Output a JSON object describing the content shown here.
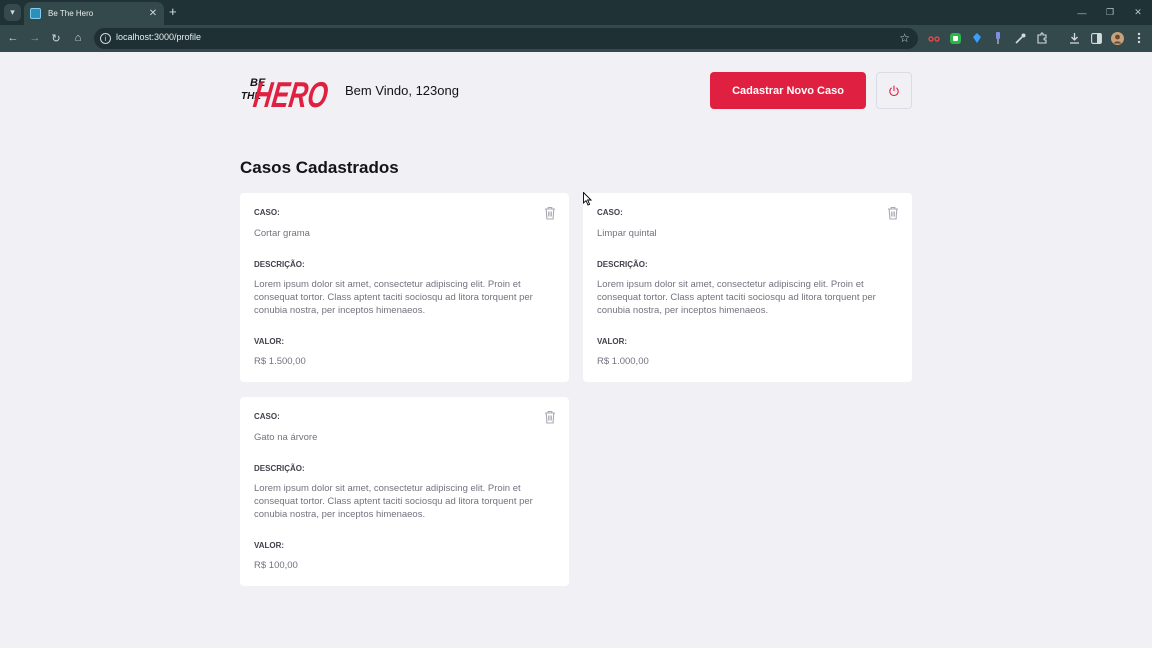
{
  "browser": {
    "tab_title": "Be The Hero",
    "url": "localhost:3000/profile"
  },
  "header": {
    "logo_text_top": "BE",
    "logo_text_mid": "THE",
    "logo_text_big": "HERO",
    "welcome": "Bem Vindo, 123ong",
    "new_case_label": "Cadastrar Novo Caso"
  },
  "page": {
    "title": "Casos Cadastrados"
  },
  "labels": {
    "case": "CASO:",
    "description": "DESCRIÇÃO:",
    "value": "VALOR:"
  },
  "cases": [
    {
      "title": "Cortar grama",
      "description": "Lorem ipsum dolor sit amet, consectetur adipiscing elit. Proin et consequat tortor. Class aptent taciti sociosqu ad litora torquent per conubia nostra, per inceptos himenaeos.",
      "value": "R$ 1.500,00"
    },
    {
      "title": "Limpar quintal",
      "description": "Lorem ipsum dolor sit amet, consectetur adipiscing elit. Proin et consequat tortor. Class aptent taciti sociosqu ad litora torquent per conubia nostra, per inceptos himenaeos.",
      "value": "R$ 1.000,00"
    },
    {
      "title": "Gato na árvore",
      "description": "Lorem ipsum dolor sit amet, consectetur adipiscing elit. Proin et consequat tortor. Class aptent taciti sociosqu ad litora torquent per conubia nostra, per inceptos himenaeos.",
      "value": "R$ 100,00"
    }
  ],
  "colors": {
    "brand": "#e02041",
    "background": "#f0f0f5",
    "card": "#ffffff",
    "text": "#13131a",
    "muted": "#737380"
  },
  "icons": [
    "chevron-down-icon",
    "close-icon",
    "plus-icon",
    "back-icon",
    "forward-icon",
    "reload-icon",
    "home-icon",
    "info-icon",
    "star-icon",
    "trash-icon",
    "power-icon"
  ]
}
